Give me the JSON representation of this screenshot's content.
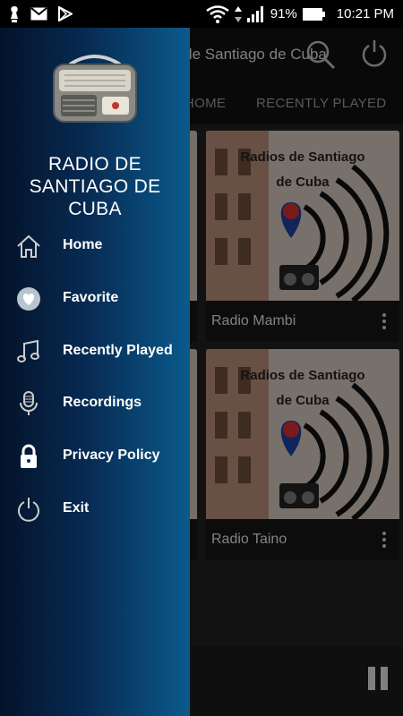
{
  "status_bar": {
    "battery": "91%",
    "time": "10:21 PM"
  },
  "app_bar": {
    "title": "Radio de Santiago de Cuba"
  },
  "tabs": [
    {
      "label": "HOME"
    },
    {
      "label": "RECENTLY PLAYED"
    }
  ],
  "cards": [
    {
      "name": "Radio Mambi",
      "logo_line1": "Radios de Santiago",
      "logo_line2": "de Cuba"
    },
    {
      "name": "Radio Taino",
      "logo_line1": "Radios de Santiago",
      "logo_line2": "de Cuba"
    }
  ],
  "drawer": {
    "title_line1": "RADIO DE",
    "title_line2": "SANTIAGO DE",
    "title_line3": "CUBA",
    "items": [
      {
        "label": "Home",
        "icon": "home-icon"
      },
      {
        "label": "Favorite",
        "icon": "heart-icon"
      },
      {
        "label": "Recently Played",
        "icon": "music-note-icon"
      },
      {
        "label": "Recordings",
        "icon": "microphone-icon"
      },
      {
        "label": "Privacy Policy",
        "icon": "lock-icon"
      },
      {
        "label": "Exit",
        "icon": "power-icon"
      }
    ]
  },
  "colors": {
    "drawer_dark": "#04132a",
    "drawer_light": "#0a5a8c",
    "background": "#202020",
    "flag_red": "#d32f2f",
    "flag_blue": "#1e3f9e"
  }
}
